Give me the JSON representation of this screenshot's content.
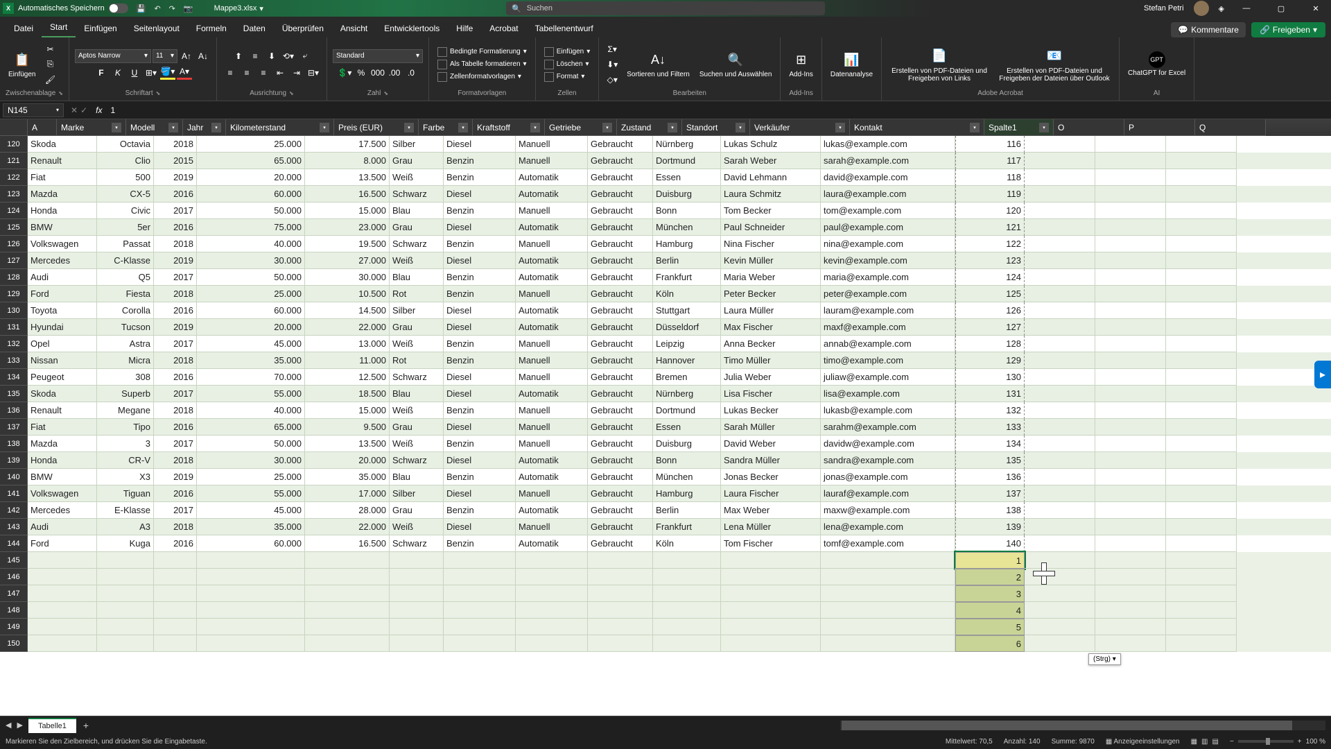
{
  "title": {
    "autosave": "Automatisches Speichern",
    "filename": "Mappe3.xlsx",
    "search": "Suchen",
    "user": "Stefan Petri"
  },
  "tabs": {
    "file": "Datei",
    "list": [
      "Start",
      "Einfügen",
      "Seitenlayout",
      "Formeln",
      "Daten",
      "Überprüfen",
      "Ansicht",
      "Entwicklertools",
      "Hilfe",
      "Acrobat",
      "Tabellenentwurf"
    ],
    "active": "Start",
    "kommentare": "Kommentare",
    "freigeben": "Freigeben"
  },
  "ribbon": {
    "clipboard": {
      "paste": "Einfügen",
      "label": "Zwischenablage"
    },
    "font": {
      "name": "Aptos Narrow",
      "size": "11",
      "label": "Schriftart"
    },
    "align": {
      "label": "Ausrichtung"
    },
    "number": {
      "format": "Standard",
      "label": "Zahl"
    },
    "styles": {
      "cond": "Bedingte Formatierung",
      "table": "Als Tabelle formatieren",
      "cell": "Zellenformatvorlagen",
      "label": "Formatvorlagen"
    },
    "cells": {
      "insert": "Einfügen",
      "delete": "Löschen",
      "format": "Format",
      "label": "Zellen"
    },
    "editing": {
      "sort": "Sortieren und Filtern",
      "find": "Suchen und Auswählen",
      "label": "Bearbeiten"
    },
    "addins": {
      "addins": "Add-Ins",
      "label": "Add-Ins"
    },
    "analysis": {
      "label": "Datenanalyse"
    },
    "acrobat": {
      "create": "Erstellen von PDF-Dateien und Freigeben von Links",
      "embed": "Erstellen von PDF-Dateien und Freigeben der Dateien über Outlook",
      "label": "Adobe Acrobat"
    },
    "ai": {
      "chat": "ChatGPT for Excel",
      "label": "AI"
    }
  },
  "formula": {
    "cell": "N145",
    "value": "1"
  },
  "columns": [
    "A",
    "Marke",
    "Modell",
    "Jahr",
    "Kilometerstand",
    "Preis (EUR)",
    "Farbe",
    "Kraftstoff",
    "Getriebe",
    "Zustand",
    "Standort",
    "Verkäufer",
    "Kontakt",
    "Spalte1",
    "O",
    "P",
    "Q"
  ],
  "rows": [
    {
      "n": 120,
      "d": [
        "Skoda",
        "Octavia",
        "2018",
        "25.000",
        "17.500",
        "Silber",
        "Diesel",
        "Manuell",
        "Gebraucht",
        "Nürnberg",
        "Lukas Schulz",
        "lukas@example.com",
        "116"
      ]
    },
    {
      "n": 121,
      "d": [
        "Renault",
        "Clio",
        "2015",
        "65.000",
        "8.000",
        "Grau",
        "Benzin",
        "Manuell",
        "Gebraucht",
        "Dortmund",
        "Sarah Weber",
        "sarah@example.com",
        "117"
      ]
    },
    {
      "n": 122,
      "d": [
        "Fiat",
        "500",
        "2019",
        "20.000",
        "13.500",
        "Weiß",
        "Benzin",
        "Automatik",
        "Gebraucht",
        "Essen",
        "David Lehmann",
        "david@example.com",
        "118"
      ]
    },
    {
      "n": 123,
      "d": [
        "Mazda",
        "CX-5",
        "2016",
        "60.000",
        "16.500",
        "Schwarz",
        "Diesel",
        "Automatik",
        "Gebraucht",
        "Duisburg",
        "Laura Schmitz",
        "laura@example.com",
        "119"
      ]
    },
    {
      "n": 124,
      "d": [
        "Honda",
        "Civic",
        "2017",
        "50.000",
        "15.000",
        "Blau",
        "Benzin",
        "Manuell",
        "Gebraucht",
        "Bonn",
        "Tom Becker",
        "tom@example.com",
        "120"
      ]
    },
    {
      "n": 125,
      "d": [
        "BMW",
        "5er",
        "2016",
        "75.000",
        "23.000",
        "Grau",
        "Diesel",
        "Automatik",
        "Gebraucht",
        "München",
        "Paul Schneider",
        "paul@example.com",
        "121"
      ]
    },
    {
      "n": 126,
      "d": [
        "Volkswagen",
        "Passat",
        "2018",
        "40.000",
        "19.500",
        "Schwarz",
        "Benzin",
        "Manuell",
        "Gebraucht",
        "Hamburg",
        "Nina Fischer",
        "nina@example.com",
        "122"
      ]
    },
    {
      "n": 127,
      "d": [
        "Mercedes",
        "C-Klasse",
        "2019",
        "30.000",
        "27.000",
        "Weiß",
        "Diesel",
        "Automatik",
        "Gebraucht",
        "Berlin",
        "Kevin Müller",
        "kevin@example.com",
        "123"
      ]
    },
    {
      "n": 128,
      "d": [
        "Audi",
        "Q5",
        "2017",
        "50.000",
        "30.000",
        "Blau",
        "Benzin",
        "Automatik",
        "Gebraucht",
        "Frankfurt",
        "Maria Weber",
        "maria@example.com",
        "124"
      ]
    },
    {
      "n": 129,
      "d": [
        "Ford",
        "Fiesta",
        "2018",
        "25.000",
        "10.500",
        "Rot",
        "Benzin",
        "Manuell",
        "Gebraucht",
        "Köln",
        "Peter Becker",
        "peter@example.com",
        "125"
      ]
    },
    {
      "n": 130,
      "d": [
        "Toyota",
        "Corolla",
        "2016",
        "60.000",
        "14.500",
        "Silber",
        "Diesel",
        "Automatik",
        "Gebraucht",
        "Stuttgart",
        "Laura Müller",
        "lauram@example.com",
        "126"
      ]
    },
    {
      "n": 131,
      "d": [
        "Hyundai",
        "Tucson",
        "2019",
        "20.000",
        "22.000",
        "Grau",
        "Diesel",
        "Automatik",
        "Gebraucht",
        "Düsseldorf",
        "Max Fischer",
        "maxf@example.com",
        "127"
      ]
    },
    {
      "n": 132,
      "d": [
        "Opel",
        "Astra",
        "2017",
        "45.000",
        "13.000",
        "Weiß",
        "Benzin",
        "Manuell",
        "Gebraucht",
        "Leipzig",
        "Anna Becker",
        "annab@example.com",
        "128"
      ]
    },
    {
      "n": 133,
      "d": [
        "Nissan",
        "Micra",
        "2018",
        "35.000",
        "11.000",
        "Rot",
        "Benzin",
        "Manuell",
        "Gebraucht",
        "Hannover",
        "Timo Müller",
        "timo@example.com",
        "129"
      ]
    },
    {
      "n": 134,
      "d": [
        "Peugeot",
        "308",
        "2016",
        "70.000",
        "12.500",
        "Schwarz",
        "Diesel",
        "Manuell",
        "Gebraucht",
        "Bremen",
        "Julia Weber",
        "juliaw@example.com",
        "130"
      ]
    },
    {
      "n": 135,
      "d": [
        "Skoda",
        "Superb",
        "2017",
        "55.000",
        "18.500",
        "Blau",
        "Diesel",
        "Automatik",
        "Gebraucht",
        "Nürnberg",
        "Lisa Fischer",
        "lisa@example.com",
        "131"
      ]
    },
    {
      "n": 136,
      "d": [
        "Renault",
        "Megane",
        "2018",
        "40.000",
        "15.000",
        "Weiß",
        "Benzin",
        "Manuell",
        "Gebraucht",
        "Dortmund",
        "Lukas Becker",
        "lukasb@example.com",
        "132"
      ]
    },
    {
      "n": 137,
      "d": [
        "Fiat",
        "Tipo",
        "2016",
        "65.000",
        "9.500",
        "Grau",
        "Diesel",
        "Manuell",
        "Gebraucht",
        "Essen",
        "Sarah Müller",
        "sarahm@example.com",
        "133"
      ]
    },
    {
      "n": 138,
      "d": [
        "Mazda",
        "3",
        "2017",
        "50.000",
        "13.500",
        "Weiß",
        "Benzin",
        "Manuell",
        "Gebraucht",
        "Duisburg",
        "David Weber",
        "davidw@example.com",
        "134"
      ]
    },
    {
      "n": 139,
      "d": [
        "Honda",
        "CR-V",
        "2018",
        "30.000",
        "20.000",
        "Schwarz",
        "Diesel",
        "Automatik",
        "Gebraucht",
        "Bonn",
        "Sandra Müller",
        "sandra@example.com",
        "135"
      ]
    },
    {
      "n": 140,
      "d": [
        "BMW",
        "X3",
        "2019",
        "25.000",
        "35.000",
        "Blau",
        "Benzin",
        "Automatik",
        "Gebraucht",
        "München",
        "Jonas Becker",
        "jonas@example.com",
        "136"
      ]
    },
    {
      "n": 141,
      "d": [
        "Volkswagen",
        "Tiguan",
        "2016",
        "55.000",
        "17.000",
        "Silber",
        "Diesel",
        "Manuell",
        "Gebraucht",
        "Hamburg",
        "Laura Fischer",
        "lauraf@example.com",
        "137"
      ]
    },
    {
      "n": 142,
      "d": [
        "Mercedes",
        "E-Klasse",
        "2017",
        "45.000",
        "28.000",
        "Grau",
        "Benzin",
        "Automatik",
        "Gebraucht",
        "Berlin",
        "Max Weber",
        "maxw@example.com",
        "138"
      ]
    },
    {
      "n": 143,
      "d": [
        "Audi",
        "A3",
        "2018",
        "35.000",
        "22.000",
        "Weiß",
        "Diesel",
        "Manuell",
        "Gebraucht",
        "Frankfurt",
        "Lena Müller",
        "lena@example.com",
        "139"
      ]
    },
    {
      "n": 144,
      "d": [
        "Ford",
        "Kuga",
        "2016",
        "60.000",
        "16.500",
        "Schwarz",
        "Benzin",
        "Automatik",
        "Gebraucht",
        "Köln",
        "Tom Fischer",
        "tomf@example.com",
        "140"
      ]
    }
  ],
  "fillRows": [
    {
      "n": 145,
      "v": "1"
    },
    {
      "n": 146,
      "v": "2"
    },
    {
      "n": 147,
      "v": "3"
    },
    {
      "n": 148,
      "v": "4"
    },
    {
      "n": 149,
      "v": "5"
    },
    {
      "n": 150,
      "v": "6"
    }
  ],
  "sheet": {
    "tab": "Tabelle1"
  },
  "status": {
    "msg": "Markieren Sie den Zielbereich, und drücken Sie die Eingabetaste.",
    "avg": "Mittelwert: 70,5",
    "count": "Anzahl: 140",
    "sum": "Summe: 9870",
    "display": "Anzeigeeinstellungen",
    "zoom": "100 %"
  },
  "ctrl": "(Strg) ▾"
}
